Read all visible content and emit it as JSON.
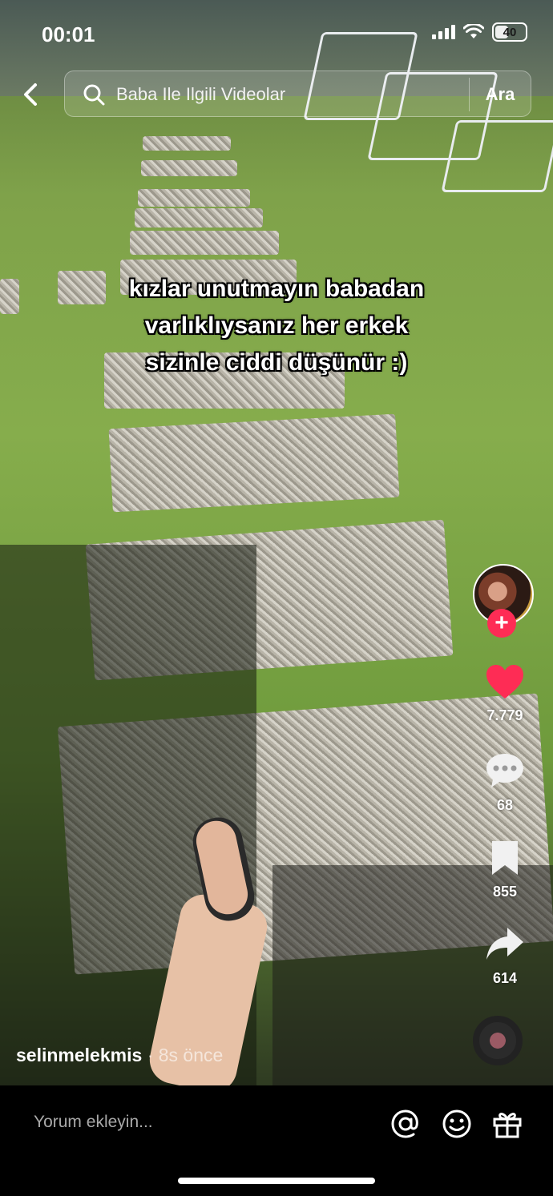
{
  "status_bar": {
    "time": "00:01",
    "battery": "40"
  },
  "search": {
    "query": "Baba Ile Ilgili Videolar",
    "button_label": "Ara"
  },
  "caption": {
    "line1": "kızlar unutmayın babadan",
    "line2": "varlıklıysanız her erkek",
    "line3": "sizinle ciddi düşünür :)"
  },
  "actions": {
    "likes": "7.779",
    "comments": "68",
    "saves": "855",
    "shares": "614"
  },
  "author": {
    "username": "selinmelekmis",
    "separator": "·",
    "posted": "8s önce"
  },
  "comment_bar": {
    "placeholder": "Yorum ekleyin..."
  },
  "colors": {
    "accent": "#fe2c55",
    "like": "#fe2c55",
    "background": "#000000"
  },
  "icons": [
    "back-icon",
    "search-icon",
    "plus-icon",
    "heart-icon",
    "comment-icon",
    "bookmark-icon",
    "share-icon",
    "music-disc-icon",
    "at-icon",
    "emoji-icon",
    "gift-icon"
  ]
}
